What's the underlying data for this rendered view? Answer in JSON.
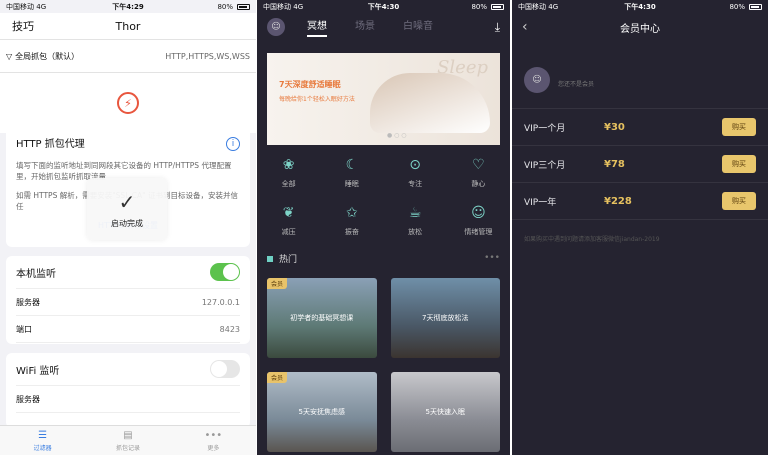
{
  "p1": {
    "status": {
      "carrier": "中国移动",
      "net": "4G",
      "time": "下午4:29",
      "battery": "80%"
    },
    "nav": {
      "left": "技巧",
      "title": "Thor"
    },
    "filter": {
      "label": "全局抓包（默认）",
      "value": "HTTP,HTTPS,WS,WSS"
    },
    "proxy": {
      "title": "HTTP 抓包代理",
      "desc1": "填写下面的监听地址到同网段其它设备的 HTTP/HTTPS 代理配置里，开始抓包监听抓取流量",
      "desc2": "如需 HTTPS 解析，需要安装\"SSL CA\" 证书到目标设备，安装并信任",
      "link": "HTTPS 解析设置"
    },
    "toast": "启动完成",
    "local": {
      "label": "本机监听",
      "server_label": "服务器",
      "server": "127.0.0.1",
      "port_label": "端口",
      "port": "8423"
    },
    "wifi": {
      "label": "WiFi 监听",
      "server_label": "服务器"
    },
    "tabs": [
      {
        "label": "过滤器"
      },
      {
        "label": "抓包记录"
      },
      {
        "label": "更多"
      }
    ]
  },
  "p2": {
    "status": {
      "carrier": "中国移动",
      "net": "4G",
      "time": "下午4:30",
      "battery": "80%"
    },
    "tabs": [
      "冥想",
      "场景",
      "白噪音"
    ],
    "banner": {
      "title": "7天深度舒适睡眠",
      "sub": "每晚给你1个轻松入眠好方法",
      "script": "Sleep"
    },
    "cats": [
      "全部",
      "睡眠",
      "专注",
      "静心",
      "减压",
      "振奋",
      "放松",
      "情绪管理"
    ],
    "hot": "热门",
    "cards": [
      {
        "tag": "会员",
        "title": "初学者的基础冥想课"
      },
      {
        "tag": "",
        "title": "7天彻底放松法"
      },
      {
        "tag": "会员",
        "title": "5天安抚焦虑感"
      },
      {
        "tag": "",
        "title": "5天快速入眠"
      }
    ]
  },
  "p3": {
    "status": {
      "carrier": "中国移动",
      "net": "4G",
      "time": "下午4:30",
      "battery": "80%"
    },
    "title": "会员中心",
    "member_text": "您还不是会员",
    "plans": [
      {
        "name": "VIP一个月",
        "price": "¥30",
        "buy": "购买"
      },
      {
        "name": "VIP三个月",
        "price": "¥78",
        "buy": "购买"
      },
      {
        "name": "VIP一年",
        "price": "¥228",
        "buy": "购买"
      }
    ],
    "note": "如果购买中遇到问题请添加客服微信jiandan-2019"
  }
}
